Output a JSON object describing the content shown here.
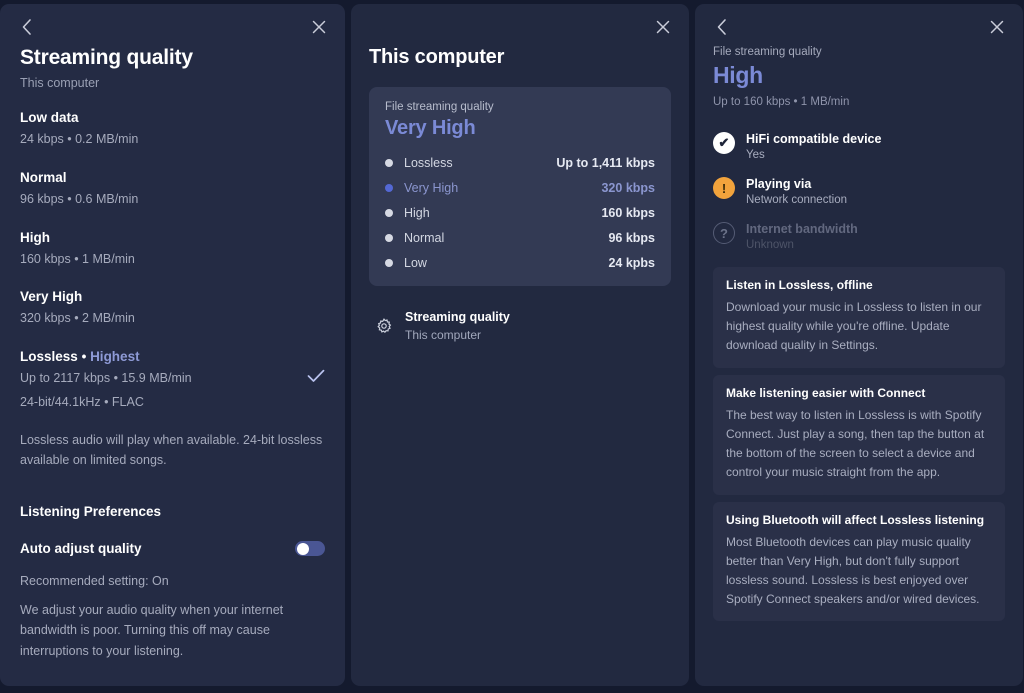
{
  "left": {
    "back_icon": "chevron-left-icon",
    "close_icon": "close-icon",
    "title": "Streaming quality",
    "subtitle": "This computer",
    "options": [
      {
        "name": "Low data",
        "detail": "24 kbps • 0.2 MB/min",
        "selected": false
      },
      {
        "name": "Normal",
        "detail": "96 kbps • 0.6 MB/min",
        "selected": false
      },
      {
        "name": "High",
        "detail": "160 kbps • 1 MB/min",
        "selected": false
      },
      {
        "name": "Very High",
        "detail": "320 kbps • 2 MB/min",
        "selected": false
      }
    ],
    "lossless": {
      "name": "Lossless",
      "separator": "•",
      "badge": "Highest",
      "detail": "Up to 2117 kbps • 15.9 MB/min",
      "detail2": "24-bit/44.1kHz • FLAC",
      "selected": true,
      "check_icon": "check-icon"
    },
    "note": "Lossless audio will play when available. 24-bit lossless available on limited songs.",
    "preferences_heading": "Listening Preferences",
    "auto_adjust": {
      "label": "Auto adjust quality",
      "state": "on",
      "recommended": "Recommended setting: On",
      "description": "We adjust your audio quality when your internet bandwidth is poor. Turning this off may cause interruptions to your listening."
    }
  },
  "middle": {
    "close_icon": "close-icon",
    "title": "This computer",
    "card": {
      "label": "File streaming quality",
      "value": "Very High",
      "bitrates": [
        {
          "name": "Lossless",
          "value": "Up to 1,411 kbps",
          "active": false
        },
        {
          "name": "Very High",
          "value": "320 kbps",
          "active": true
        },
        {
          "name": "High",
          "value": "160 kbps",
          "active": false
        },
        {
          "name": "Normal",
          "value": "96 kbps",
          "active": false
        },
        {
          "name": "Low",
          "value": "24 kpbs",
          "active": false
        }
      ]
    },
    "settings_row": {
      "icon": "gear-icon",
      "title": "Streaming quality",
      "subtitle": "This computer"
    }
  },
  "right": {
    "back_icon": "chevron-left-icon",
    "close_icon": "close-icon",
    "label": "File streaming quality",
    "value": "High",
    "sub": "Up to 160 kbps • 1 MB/min",
    "statuses": [
      {
        "icon": "check-circle-icon",
        "glyph": "✔",
        "style": "ok",
        "title": "HiFi compatible device",
        "value": "Yes"
      },
      {
        "icon": "warning-circle-icon",
        "glyph": "!",
        "style": "warn",
        "title": "Playing via",
        "value": "Network connection"
      },
      {
        "icon": "question-circle-icon",
        "glyph": "?",
        "style": "unk",
        "title": "Internet bandwidth",
        "value": "Unknown"
      }
    ],
    "tips": [
      {
        "heading": "Listen in Lossless, offline",
        "body": "Download your music in Lossless to listen in our highest quality while you're offline. Update download quality in Settings."
      },
      {
        "heading": "Make listening easier with Connect",
        "body": "The best way to listen in Lossless is with Spotify Connect. Just play a song, then tap the button at the bottom of the screen to select a device and control your music straight from the app."
      },
      {
        "heading": "Using Bluetooth will affect Lossless listening",
        "body": "Most Bluetooth devices can play music quality better than Very High, but don't fully support lossless sound. Lossless is best enjoyed over Spotify Connect speakers and/or wired devices."
      }
    ]
  },
  "theme": {
    "accent": "#7b8ad6",
    "active_dot": "#5468d4",
    "warn": "#f2a33c",
    "panel_bg": "#222940",
    "card_bg": "#333a54"
  }
}
